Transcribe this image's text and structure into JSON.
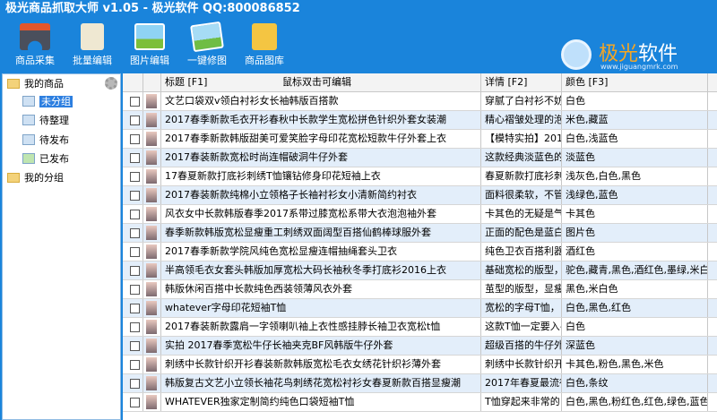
{
  "window": {
    "title": "极光商品抓取大师 v1.05 - 极光软件 QQ:800086852"
  },
  "toolbar": [
    {
      "label": "商品采集",
      "icon": "magnet-icon"
    },
    {
      "label": "批量编辑",
      "icon": "document-edit-icon"
    },
    {
      "label": "图片编辑",
      "icon": "image-icon"
    },
    {
      "label": "一键修图",
      "icon": "image-repair-icon"
    },
    {
      "label": "商品图库",
      "icon": "gallery-folder-icon"
    }
  ],
  "logo": {
    "name_a": "极光",
    "name_b": "软件",
    "url": "www.jiguangmrk.com"
  },
  "tree": {
    "root1": "我的商品",
    "children": [
      "未分组",
      "待整理",
      "待发布",
      "已发布"
    ],
    "selected": "未分组",
    "root2": "我的分组"
  },
  "grid": {
    "headers": {
      "title": "标题 [F1]",
      "title_hint": "鼠标双击可编辑",
      "detail": "详情 [F2]",
      "color": "颜色 [F3]"
    },
    "rows": [
      {
        "title": "文艺口袋双v领白衬衫女长袖韩版百搭款",
        "detail": "穿腻了白衬衫不妨",
        "color": "白色"
      },
      {
        "title": "2017春季新款毛衣开衫春秋中长款学生宽松拼色针织外套女装潮",
        "detail": "精心褶皱处理的泡",
        "color": "米色,藏蓝"
      },
      {
        "title": "2017春季新款韩版甜美可爱笑脸字母印花宽松短款牛仔外套上衣",
        "detail": "【模特实拍】201",
        "color": "白色,浅蓝色"
      },
      {
        "title": "2017春装新款宽松时尚连帽破洞牛仔外套",
        "detail": "这款经典淡蓝色的",
        "color": "淡蓝色"
      },
      {
        "title": "17春夏新款打底衫刺绣T恤镶钻修身印花短袖上衣",
        "detail": "春夏新款打底衫刺",
        "color": "浅灰色,白色,黑色"
      },
      {
        "title": "2017春装新款纯棉小立领格子长袖衬衫女小清新简约衬衣",
        "detail": "面料很柔软，不管",
        "color": "浅绿色,蓝色"
      },
      {
        "title": "风衣女中长款韩版春季2017系带过膝宽松系带大衣泡泡袖外套",
        "detail": "卡其色的无疑是气",
        "color": "卡其色"
      },
      {
        "title": "春季新款韩版宽松显瘦重工刺绣双面阔型百搭仙鹤棒球服外套",
        "detail": "正面的配色是蓝白",
        "color": "图片色"
      },
      {
        "title": "2017春季新款学院风纯色宽松显瘦连帽抽绳套头卫衣",
        "detail": "纯色卫衣百搭利器",
        "color": "酒红色"
      },
      {
        "title": "半高领毛衣女套头韩版加厚宽松大码长袖秋冬季打底衫2016上衣",
        "detail": "基础宽松的版型，",
        "color": "驼色,藏青,黑色,酒红色,墨绿,米白色"
      },
      {
        "title": "韩版休闲百搭中长款纯色西装领薄风衣外套",
        "detail": "茧型的版型，显瘦",
        "color": "黑色,米白色"
      },
      {
        "title": "whatever字母印花短袖T恤",
        "detail": "宽松的字母T恤，",
        "color": "白色,黑色,红色"
      },
      {
        "title": "2017春装新款露肩一字领喇叭袖上衣性感挂脖长袖卫衣宽松t恤",
        "detail": "这款T恤一定要入手",
        "color": "白色"
      },
      {
        "title": "实拍 2017春季宽松牛仔长袖夹克BF风韩版牛仔外套",
        "detail": "超级百搭的牛仔外",
        "color": "深蓝色"
      },
      {
        "title": "刺绣中长款针织开衫春装新款韩版宽松毛衣女绣花针织衫薄外套",
        "detail": "刺绣中长款针织开",
        "color": "卡其色,粉色,黑色,米色"
      },
      {
        "title": "韩版复古文艺小立领长袖花鸟刺绣花宽松衬衫女春夏新款百搭显瘦潮",
        "detail": "2017年春夏最流行",
        "color": "白色,条纹"
      },
      {
        "title": "WHATEVER独家定制简约纯色口袋短袖T恤",
        "detail": "T恤穿起来非常的",
        "color": "白色,黑色,粉红色,红色,绿色,蓝色"
      }
    ]
  }
}
